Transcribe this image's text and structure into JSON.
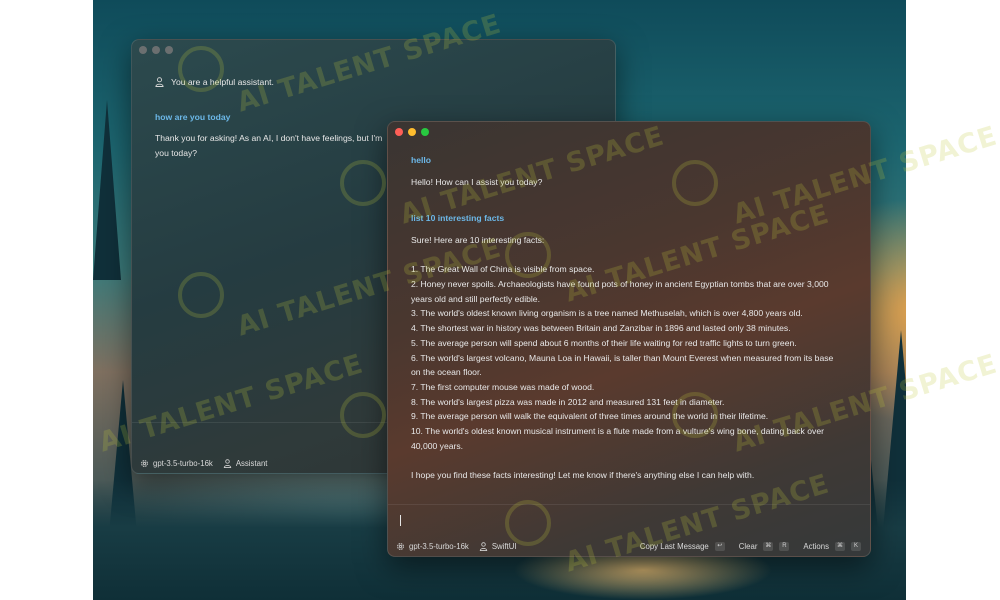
{
  "back_window": {
    "system_prompt": "You are a helpful assistant.",
    "user_message": "how are you today",
    "assistant_reply": "Thank you for asking! As an AI, I don't have feelings, but I'm",
    "assistant_reply_line2": "you today?",
    "footer": {
      "model": "gpt-3.5-turbo-16k",
      "persona": "Assistant"
    }
  },
  "front_window": {
    "messages": [
      {
        "role": "user",
        "text": "hello"
      },
      {
        "role": "assistant",
        "text": "Hello! How can I assist you today?"
      },
      {
        "role": "user",
        "text": "list 10 interesting facts"
      }
    ],
    "reply_intro": "Sure! Here are 10 interesting facts:",
    "facts": [
      "1. The Great Wall of China is visible from space.",
      "2. Honey never spoils. Archaeologists have found pots of honey in ancient Egyptian tombs that are over 3,000",
      "years old and still perfectly edible.",
      "3. The world's oldest known living organism is a tree named Methuselah, which is over 4,800 years old.",
      "4. The shortest war in history was between Britain and Zanzibar in 1896 and lasted only 38 minutes.",
      "5. The average person will spend about 6 months of their life waiting for red traffic lights to turn green.",
      "6. The world's largest volcano, Mauna Loa in Hawaii, is taller than Mount Everest when measured from its base",
      "on the ocean floor.",
      "7. The first computer mouse was made of wood.",
      "8. The world's largest pizza was made in 2012 and measured 131 feet in diameter.",
      "9. The average person will walk the equivalent of three times around the world in their lifetime.",
      "10. The world's oldest known musical instrument is a flute made from a vulture's wing bone, dating back over",
      "40,000 years."
    ],
    "reply_outro": "I hope you find these facts interesting! Let me know if there's anything else I can help with.",
    "footer": {
      "model": "gpt-3.5-turbo-16k",
      "persona": "SwiftUI",
      "copy_label": "Copy Last Message",
      "copy_key": "↩",
      "clear_label": "Clear",
      "clear_keys": [
        "⌘",
        "R"
      ],
      "actions_label": "Actions",
      "actions_keys": [
        "⌘",
        "K"
      ]
    }
  },
  "watermark": "AI TALENT SPACE"
}
